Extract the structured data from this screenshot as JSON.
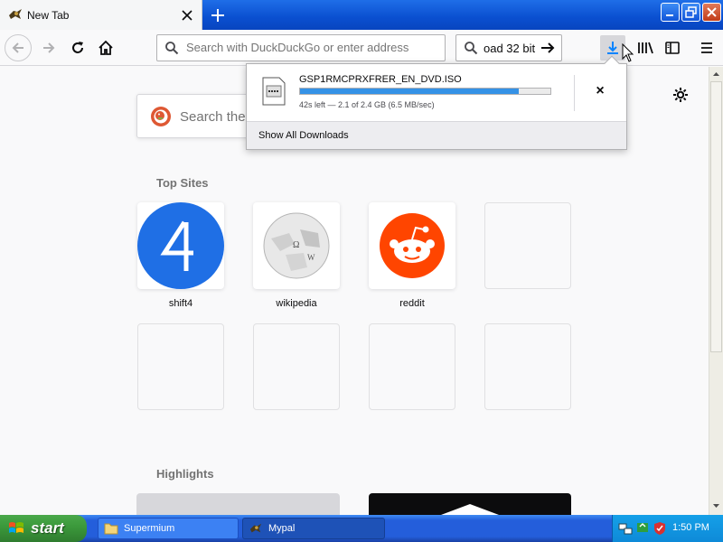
{
  "browser": {
    "tab_title": "New Tab",
    "url_placeholder": "Search with DuckDuckGo or enter address",
    "search_value": "oad 32 bit"
  },
  "newtab": {
    "search_placeholder": "Search the",
    "top_sites_title": "Top Sites",
    "top_sites": [
      {
        "label": "shift4",
        "icon": "shift4-logo"
      },
      {
        "label": "wikipedia",
        "icon": "wikipedia-logo"
      },
      {
        "label": "reddit",
        "icon": "reddit-logo"
      }
    ],
    "highlights_title": "Highlights"
  },
  "downloads": {
    "filename": "GSP1RMCPRXFRER_EN_DVD.ISO",
    "status": "42s left — 2.1 of 2.4 GB (6.5 MB/sec)",
    "progress": 0.875,
    "cancel_label": "×",
    "show_all_label": "Show All Downloads"
  },
  "taskbar": {
    "start_label": "start",
    "items": [
      {
        "label": "Supermium"
      },
      {
        "label": "Mypal"
      }
    ],
    "clock": "1:50 PM"
  },
  "colors": {
    "accent": "#0a84ff",
    "progress": "#3592e6",
    "xp_taskbar": "#245edb",
    "start_green": "#3c9a3c",
    "reddit": "#ff4500",
    "shift4": "#1f6fe5",
    "ddg": "#de5833"
  }
}
